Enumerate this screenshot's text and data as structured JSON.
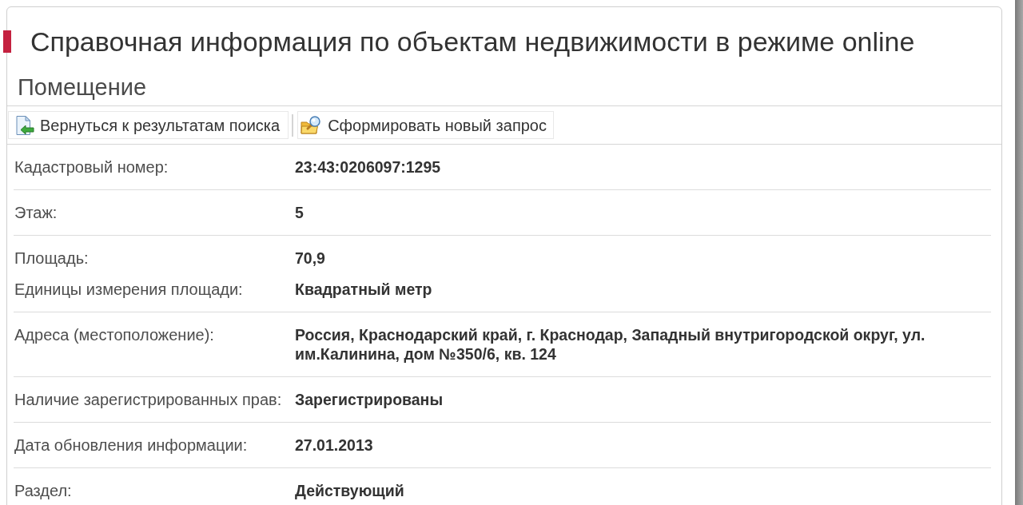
{
  "page": {
    "title": "Справочная информация по объектам недвижимости в режиме online",
    "subtitle": "Помещение"
  },
  "toolbar": [
    {
      "kind": "back",
      "label": "Вернуться к результатам поиска"
    },
    {
      "kind": "new_query",
      "label": "Сформировать новый запрос"
    }
  ],
  "details": [
    {
      "fields": [
        {
          "label": "Кадастровый номер:",
          "value": "23:43:0206097:1295"
        }
      ]
    },
    {
      "fields": [
        {
          "label": "Этаж:",
          "value": "5"
        }
      ]
    },
    {
      "fields": [
        {
          "label": "Площадь:",
          "value": "70,9"
        },
        {
          "label": "Единицы измерения площади:",
          "value": "Квадратный метр"
        }
      ]
    },
    {
      "fields": [
        {
          "label": "Адреса (местоположение):",
          "value": "Россия, Краснодарский край, г. Краснодар, Западный внутригородской округ, ул. им.Калинина, дом №350/6, кв. 124"
        }
      ]
    },
    {
      "fields": [
        {
          "label": "Наличие зарегистрированных прав:",
          "value": "Зарегистрированы"
        }
      ]
    },
    {
      "fields": [
        {
          "label": "Дата обновления информации:",
          "value": "27.01.2013"
        }
      ]
    },
    {
      "fields": [
        {
          "label": "Раздел:",
          "value": "Действующий"
        }
      ]
    }
  ]
}
